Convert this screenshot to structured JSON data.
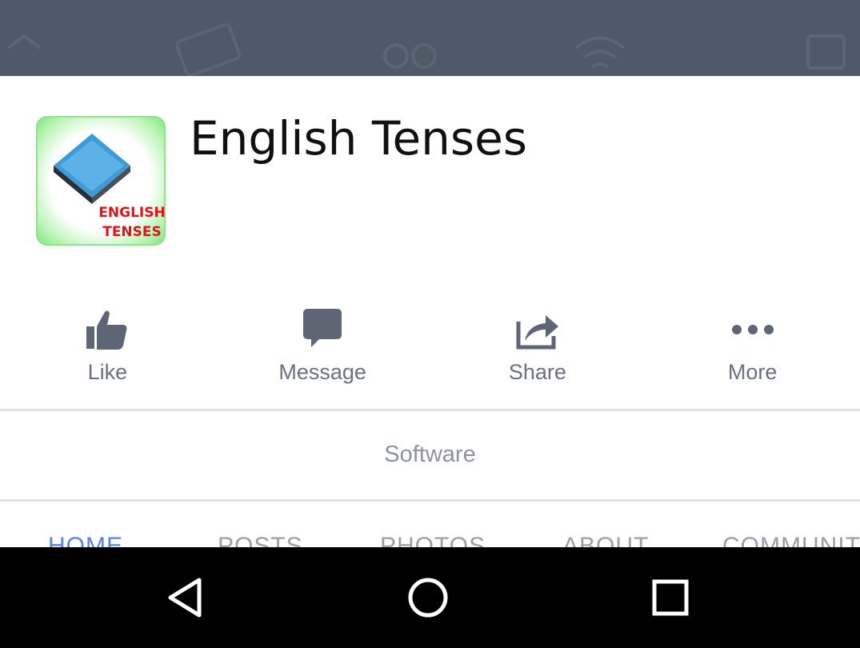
{
  "page": {
    "title": "English Tenses",
    "category": "Software",
    "icon_text_line1": "ENGLISH",
    "icon_text_line2": "TENSES"
  },
  "actions": [
    {
      "label": "Like",
      "icon": "thumbs-up-icon"
    },
    {
      "label": "Message",
      "icon": "message-bubble-icon"
    },
    {
      "label": "Share",
      "icon": "share-arrow-icon"
    },
    {
      "label": "More",
      "icon": "more-dots-icon"
    }
  ],
  "tabs": [
    {
      "label": "HOME",
      "active": true
    },
    {
      "label": "POSTS",
      "active": false
    },
    {
      "label": "PHOTOS",
      "active": false
    },
    {
      "label": "ABOUT",
      "active": false
    },
    {
      "label": "COMMUNITY",
      "active": false
    }
  ],
  "navbar": {
    "buttons": [
      "back-icon",
      "home-icon",
      "recents-icon"
    ]
  },
  "colors": {
    "cover": "#4f5968",
    "action_gray": "#6a717c",
    "active_tab": "#5b83d6",
    "icon_text_red": "#e0121b"
  }
}
